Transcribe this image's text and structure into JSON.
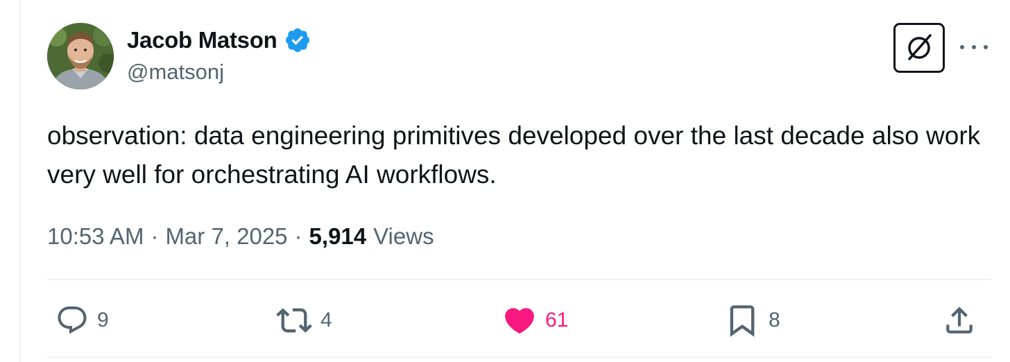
{
  "author": {
    "display_name": "Jacob Matson",
    "handle": "@matsonj",
    "verified": true,
    "verified_icon": "verified-badge-icon",
    "verified_color": "#1d9bf0"
  },
  "tweet": {
    "text": "observation: data engineering primitives developed over the last decade also work very well for orchestrating AI workflows.",
    "time": "10:53 AM",
    "date": "Mar 7, 2025",
    "separator": "·",
    "views_count": "5,914",
    "views_label": "Views"
  },
  "header_actions": {
    "grok_icon": "grok-icon",
    "more_icon": "more-icon"
  },
  "actions": {
    "reply": {
      "count": "9",
      "icon": "reply-icon"
    },
    "retweet": {
      "count": "4",
      "icon": "retweet-icon"
    },
    "like": {
      "count": "61",
      "icon": "heart-filled-icon",
      "liked": true,
      "color": "#f91880"
    },
    "bookmark": {
      "count": "8",
      "icon": "bookmark-icon"
    },
    "share": {
      "icon": "share-icon"
    }
  },
  "colors": {
    "text_primary": "#0f1419",
    "text_secondary": "#536471",
    "divider": "#eff3f4",
    "like": "#f91880",
    "verified": "#1d9bf0"
  }
}
